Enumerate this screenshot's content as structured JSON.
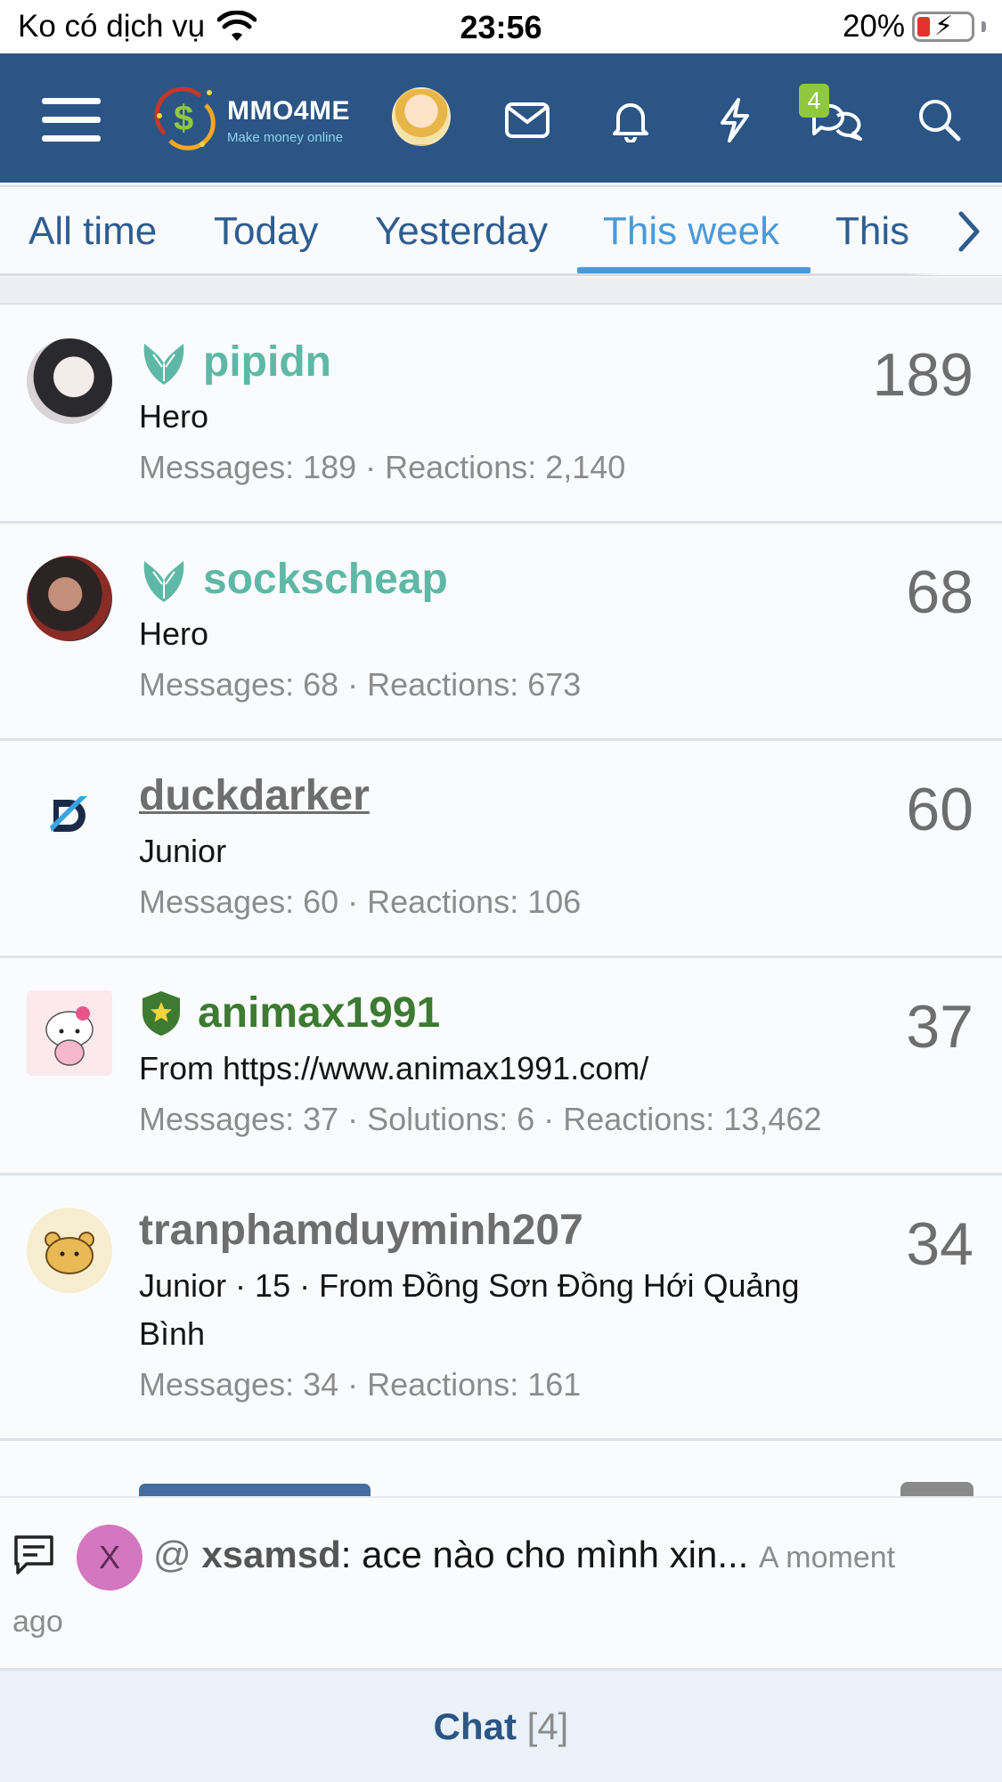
{
  "status_bar": {
    "carrier": "Ko có dịch vụ",
    "time": "23:56",
    "battery": "20%"
  },
  "header": {
    "logo_text": "MMO4ME",
    "logo_sub": "Make money online",
    "icons": [
      "menu-icon",
      "avatar",
      "mail-icon",
      "bell-icon",
      "bolt-icon",
      "chat-bubbles-icon",
      "search-icon"
    ],
    "conversations_badge": "4",
    "colors": {
      "header_bg": "#2b5585",
      "badge": "#8fc83f"
    }
  },
  "tabs": {
    "items": [
      "All time",
      "Today",
      "Yesterday",
      "This week",
      "This"
    ],
    "active": "This week"
  },
  "members": [
    {
      "username": "pipidn",
      "title": "Hero",
      "stats": "Messages: 189 · Reactions: 2,140",
      "count": "189",
      "name_color": "#5eb8a6",
      "rank_icon": "wings-icon"
    },
    {
      "username": "sockscheap",
      "title": "Hero",
      "stats": "Messages: 68 · Reactions: 673",
      "count": "68",
      "name_color": "#5eb8a6",
      "rank_icon": "wings-icon"
    },
    {
      "username": "duckdarker",
      "title": "Junior",
      "stats": "Messages: 60 · Reactions: 106",
      "count": "60",
      "name_color": "#6e6e6e",
      "rank_icon": ""
    },
    {
      "username": "animax1991",
      "title": "From https://www.animax1991.com/",
      "stats": "Messages: 37 · Solutions: 6 · Reactions: 13,462",
      "count": "37",
      "name_color": "#3d7a32",
      "rank_icon": "shield-star-icon"
    },
    {
      "username": "tranphamduyminh207",
      "title": "Junior · 15 · From Đồng Sơn Đồng Hới Quảng Bình",
      "stats": "Messages: 34 · Reactions: 161",
      "count": "34",
      "name_color": "#6e6e6e",
      "rank_icon": ""
    }
  ],
  "chat_notice": {
    "avatar_letter": "X",
    "at": "@",
    "user": "xsamsd",
    "message": ": ace nào cho mình xin...",
    "time_part1": "A moment",
    "time_part2": "ago"
  },
  "chat_bar": {
    "label": "Chat",
    "count": "[4]"
  }
}
